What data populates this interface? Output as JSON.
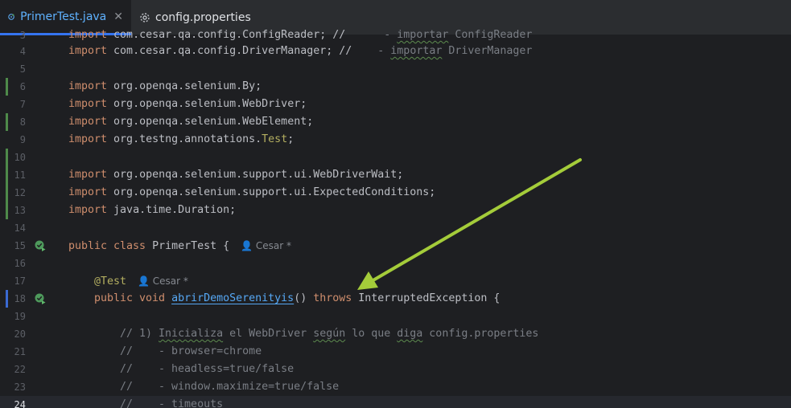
{
  "tabs": {
    "active": {
      "label": "PrimerTest.java",
      "close": "✕"
    },
    "other": {
      "label": "config.properties"
    }
  },
  "lines": {
    "l3": {
      "num": "3",
      "a": "import ",
      "b": "com.cesar.qa.config.ConfigReader; //",
      "c": "      - ",
      "d": "importar",
      "e": " ConfigReader"
    },
    "l4": {
      "num": "4",
      "a": "import ",
      "b": "com.cesar.qa.config.DriverManager; //",
      "c": "    - ",
      "d": "importar",
      "e": " DriverManager"
    },
    "l5": {
      "num": "5"
    },
    "l6": {
      "num": "6",
      "a": "import ",
      "b": "org.openqa.selenium.By;"
    },
    "l7": {
      "num": "7",
      "a": "import ",
      "b": "org.openqa.selenium.WebDriver;"
    },
    "l8": {
      "num": "8",
      "a": "import ",
      "b": "org.openqa.selenium.WebElement;"
    },
    "l9": {
      "num": "9",
      "a": "import ",
      "b": "org.testng.annotations.",
      "c": "Test",
      "d": ";"
    },
    "l10": {
      "num": "10"
    },
    "l11": {
      "num": "11",
      "a": "import ",
      "b": "org.openqa.selenium.support.ui.WebDriverWait;"
    },
    "l12": {
      "num": "12",
      "a": "import ",
      "b": "org.openqa.selenium.support.ui.ExpectedConditions;"
    },
    "l13": {
      "num": "13",
      "a": "import ",
      "b": "java.time.Duration;"
    },
    "l14": {
      "num": "14"
    },
    "l15": {
      "num": "15",
      "a": "public class ",
      "b": "PrimerTest {",
      "author": "👤 Cesar *"
    },
    "l16": {
      "num": "16"
    },
    "l17": {
      "num": "17",
      "a": "@Test",
      "author": "👤 Cesar *"
    },
    "l18": {
      "num": "18",
      "a": "public void ",
      "b": "abrirDemoSerenityis",
      "c": "() ",
      "d": "throws ",
      "e": "InterruptedException {"
    },
    "l19": {
      "num": "19"
    },
    "l20": {
      "num": "20",
      "a": "// 1) ",
      "b": "Inicializa",
      "c": " el WebDriver ",
      "d": "según",
      "e": " lo que ",
      "f": "diga",
      "g": " config.properties"
    },
    "l21": {
      "num": "21",
      "a": "//    - browser=chrome"
    },
    "l22": {
      "num": "22",
      "a": "//    - headless=true/false"
    },
    "l23": {
      "num": "23",
      "a": "//    - window.maximize=true/false"
    },
    "l24": {
      "num": "24",
      "a": "//    - timeouts"
    }
  },
  "colors": {
    "arrow": "#a4cc3a",
    "run_icon": "#4e9a5c"
  },
  "icons": {
    "tab_java": "java-class-icon",
    "tab_config": "gear-icon",
    "gutter_run": "run-test-icon"
  }
}
